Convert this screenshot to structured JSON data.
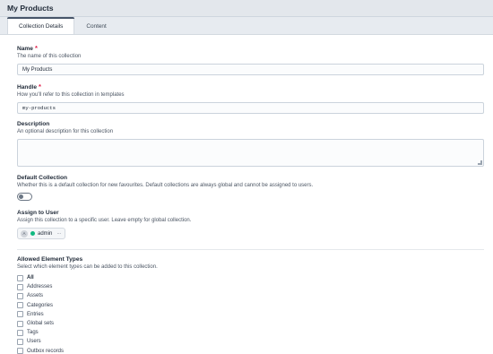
{
  "header": {
    "title": "My Products"
  },
  "tabs": [
    {
      "label": "Collection Details",
      "active": true
    },
    {
      "label": "Content",
      "active": false
    }
  ],
  "fields": {
    "name": {
      "label": "Name",
      "required_mark": "*",
      "instructions": "The name of this collection",
      "value": "My Products"
    },
    "handle": {
      "label": "Handle",
      "required_mark": "*",
      "instructions": "How you'll refer to this collection in templates",
      "value": "my-products"
    },
    "description": {
      "label": "Description",
      "instructions": "An optional description for this collection",
      "value": ""
    },
    "default_collection": {
      "label": "Default Collection",
      "instructions": "Whether this is a default collection for new favourites. Default collections are always global and cannot be assigned to users.",
      "enabled": false
    },
    "assign_to_user": {
      "label": "Assign to User",
      "instructions": "Assign this collection to a specific user. Leave empty for global collection.",
      "user": {
        "initial": "A",
        "name": "admin",
        "more": "···",
        "status_color": "#10b981"
      }
    },
    "allowed_element_types": {
      "label": "Allowed Element Types",
      "instructions": "Select which element types can be added to this collection.",
      "options": [
        {
          "label": "All",
          "checked": false,
          "bold": true
        },
        {
          "label": "Addresses",
          "checked": false
        },
        {
          "label": "Assets",
          "checked": false
        },
        {
          "label": "Categories",
          "checked": false
        },
        {
          "label": "Entries",
          "checked": false
        },
        {
          "label": "Global sets",
          "checked": false
        },
        {
          "label": "Tags",
          "checked": false
        },
        {
          "label": "Users",
          "checked": false
        },
        {
          "label": "Outbox records",
          "checked": false
        }
      ]
    }
  },
  "colors": {
    "required": "#e11d48",
    "status_active": "#10b981",
    "tab_accent": "#475569"
  }
}
